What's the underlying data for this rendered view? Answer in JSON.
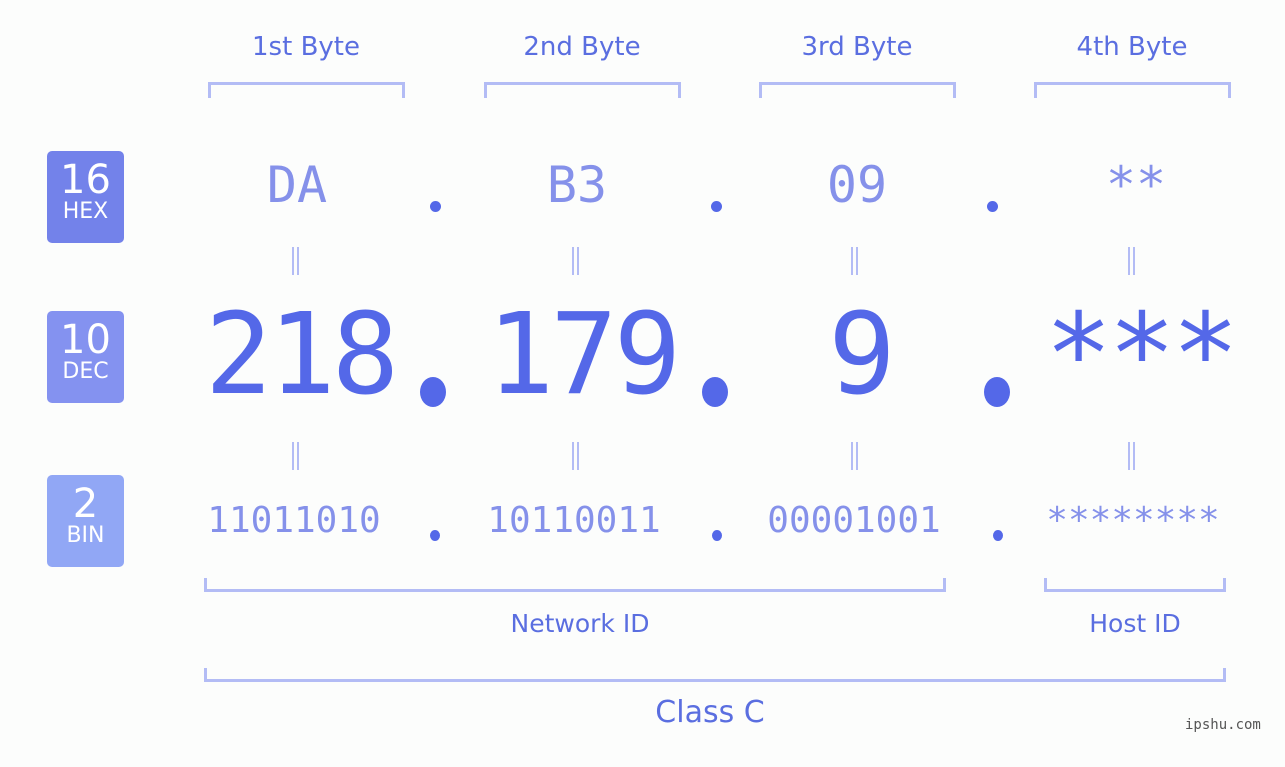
{
  "bytes": [
    {
      "label": "1st Byte",
      "hex": "DA",
      "dec": "218",
      "bin": "11011010"
    },
    {
      "label": "2nd Byte",
      "hex": "B3",
      "dec": "179",
      "bin": "10110011"
    },
    {
      "label": "3rd Byte",
      "hex": "09",
      "dec": "9",
      "bin": "00001001"
    },
    {
      "label": "4th Byte",
      "hex": "**",
      "dec": "***",
      "bin": "********"
    }
  ],
  "bases": [
    {
      "num": "16",
      "label": "HEX",
      "color": "#7382ea"
    },
    {
      "num": "10",
      "label": "DEC",
      "color": "#8492f0"
    },
    {
      "num": "2",
      "label": "BIN",
      "color": "#91a7f5"
    }
  ],
  "separator": ".",
  "sections": {
    "network_id": "Network ID",
    "host_id": "Host ID",
    "class": "Class C"
  },
  "watermark": "ipshu.com",
  "colors": {
    "accent": "#5468e8",
    "light_text": "#8591ea",
    "bracket": "#b3bcf5"
  }
}
